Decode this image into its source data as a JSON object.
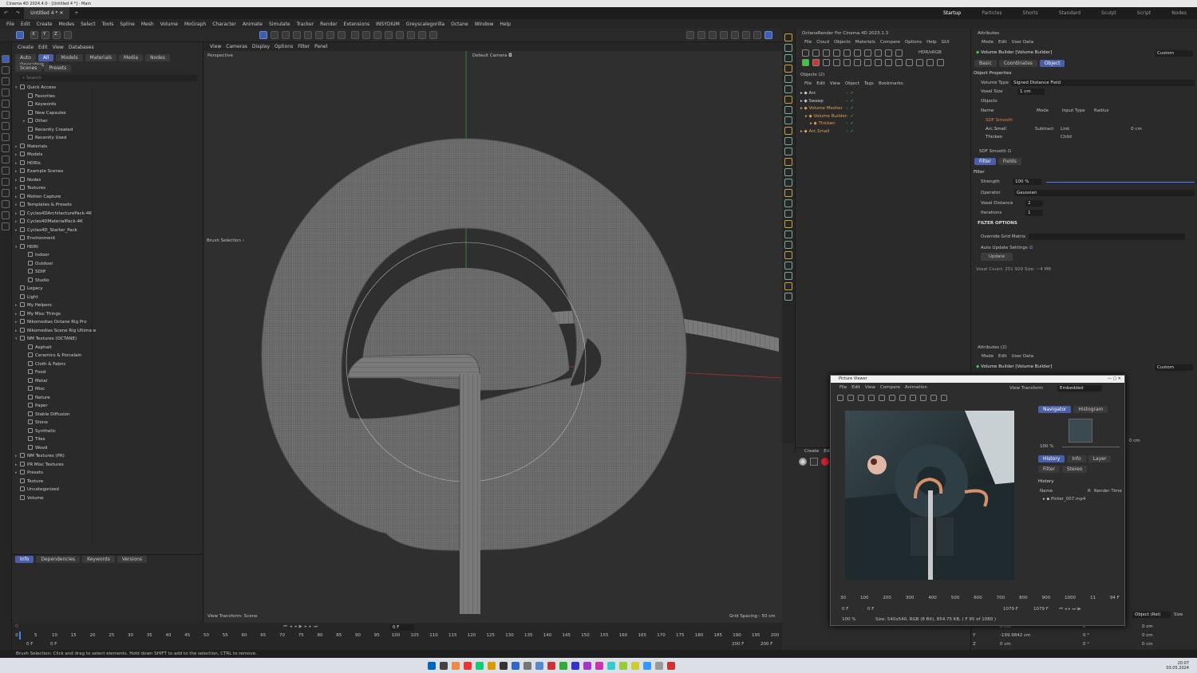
{
  "window": {
    "os_title": "Cinema 4D 2024.4.0 - [Untitled 4 *] - Main",
    "doc_tab": "Untitled 4 *",
    "layouts": [
      "Startup",
      "Particles",
      "Shorts",
      "Standard",
      "Sculpt",
      "Script",
      "Nodes"
    ],
    "active_layout": "Startup"
  },
  "menu": [
    "File",
    "Edit",
    "Create",
    "Modes",
    "Select",
    "Tools",
    "Spline",
    "Mesh",
    "Volume",
    "MoGraph",
    "Character",
    "Animate",
    "Simulate",
    "Tracker",
    "Render",
    "Extensions",
    "INSYDIUM",
    "Greyscalegorilla",
    "Octane",
    "Window",
    "Help"
  ],
  "toolbar": {
    "axes": [
      "X",
      "Y",
      "Z"
    ]
  },
  "assets": {
    "menu": [
      "Create",
      "Edit",
      "View",
      "Databases"
    ],
    "tabs": [
      "Auto",
      "All",
      "Models",
      "Materials",
      "Media",
      "Nodes",
      "Operators"
    ],
    "active_tab": "All",
    "subtabs": [
      "Scenes",
      "Presets"
    ],
    "search_placeholder": "Search",
    "tree": [
      {
        "label": "Quick Access",
        "level": 0,
        "exp": "▾"
      },
      {
        "label": "Favorites",
        "level": 1,
        "exp": ""
      },
      {
        "label": "Keywords",
        "level": 1,
        "exp": ""
      },
      {
        "label": "New Capsules",
        "level": 1,
        "exp": ""
      },
      {
        "label": "Other",
        "level": 1,
        "exp": "▸"
      },
      {
        "label": "Recently Created",
        "level": 1,
        "exp": ""
      },
      {
        "label": "Recently Used",
        "level": 1,
        "exp": ""
      },
      {
        "label": "Materials",
        "level": 0,
        "exp": "▸"
      },
      {
        "label": "Models",
        "level": 0,
        "exp": "▸"
      },
      {
        "label": "HDRIs",
        "level": 0,
        "exp": "▸"
      },
      {
        "label": "Example Scenes",
        "level": 0,
        "exp": "▸"
      },
      {
        "label": "Nodes",
        "level": 0,
        "exp": "▸"
      },
      {
        "label": "Textures",
        "level": 0,
        "exp": "▸"
      },
      {
        "label": "Motion Capture",
        "level": 0,
        "exp": "▸"
      },
      {
        "label": "Templates & Presets",
        "level": 0,
        "exp": "▸"
      },
      {
        "label": "Cycles4DArchitecturePack-4K",
        "level": 0,
        "exp": "▸"
      },
      {
        "label": "Cycles4DMaterialPack-4K",
        "level": 0,
        "exp": "▸"
      },
      {
        "label": "Cycles4D_Starter_Pack",
        "level": 0,
        "exp": "▸"
      },
      {
        "label": "Environment",
        "level": 0,
        "exp": ""
      },
      {
        "label": "HDRI",
        "level": 0,
        "exp": "▾"
      },
      {
        "label": "Indoor",
        "level": 1,
        "exp": ""
      },
      {
        "label": "Outdoor",
        "level": 1,
        "exp": ""
      },
      {
        "label": "SDiff",
        "level": 1,
        "exp": ""
      },
      {
        "label": "Studio",
        "level": 1,
        "exp": ""
      },
      {
        "label": "Legacy",
        "level": 0,
        "exp": ""
      },
      {
        "label": "Light",
        "level": 0,
        "exp": ""
      },
      {
        "label": "My Helpers",
        "level": 0,
        "exp": "▸"
      },
      {
        "label": "My Misc Things",
        "level": 0,
        "exp": "▸"
      },
      {
        "label": "Nikomedias Octane Rig Pro",
        "level": 0,
        "exp": "▸"
      },
      {
        "label": "Nikomedias Scene Rig Ultimate",
        "level": 0,
        "exp": "▸"
      },
      {
        "label": "NM Textures (OCTANE)",
        "level": 0,
        "exp": "▾"
      },
      {
        "label": "Asphalt",
        "level": 1,
        "exp": ""
      },
      {
        "label": "Ceramics & Porcelain",
        "level": 1,
        "exp": ""
      },
      {
        "label": "Cloth & Fabric",
        "level": 1,
        "exp": ""
      },
      {
        "label": "Food",
        "level": 1,
        "exp": ""
      },
      {
        "label": "Metal",
        "level": 1,
        "exp": ""
      },
      {
        "label": "Misc",
        "level": 1,
        "exp": ""
      },
      {
        "label": "Nature",
        "level": 1,
        "exp": ""
      },
      {
        "label": "Paper",
        "level": 1,
        "exp": ""
      },
      {
        "label": "Stable Diffusion",
        "level": 1,
        "exp": ""
      },
      {
        "label": "Stone",
        "level": 1,
        "exp": ""
      },
      {
        "label": "Synthetic",
        "level": 1,
        "exp": ""
      },
      {
        "label": "Tiles",
        "level": 1,
        "exp": ""
      },
      {
        "label": "Wood",
        "level": 1,
        "exp": ""
      },
      {
        "label": "NM Textures (PR)",
        "level": 0,
        "exp": "▸"
      },
      {
        "label": "PR Misc Textures",
        "level": 0,
        "exp": "▸"
      },
      {
        "label": "Presets",
        "level": 0,
        "exp": "▸"
      },
      {
        "label": "Texture",
        "level": 0,
        "exp": ""
      },
      {
        "label": "Uncategorized",
        "level": 0,
        "exp": ""
      },
      {
        "label": "Volume",
        "level": 0,
        "exp": ""
      }
    ],
    "bottom_tabs": [
      "Info",
      "Dependencies",
      "Keywords",
      "Versions"
    ],
    "active_bottom_tab": "Info"
  },
  "viewport": {
    "menu": [
      "View",
      "Cameras",
      "Display",
      "Options",
      "Filter",
      "Panel"
    ],
    "mode": "Perspective",
    "camera": "Default Camera",
    "brush_label": "Brush Selection",
    "view_transform": "View Transform: Scene",
    "grid_spacing": "Grid Spacing : 50 cm"
  },
  "octane": {
    "title": "OctaneRender For Cinema 4D 2023.1.3",
    "menu": [
      "File",
      "Cloud",
      "Objects",
      "Materials",
      "Compare",
      "Options",
      "Help",
      "GUI"
    ],
    "hdr": "HDR/sRGB"
  },
  "objects": {
    "menu": [
      "File",
      "Edit",
      "View",
      "Object",
      "Tags",
      "Bookmarks"
    ],
    "header": "Objects (2)",
    "items": [
      {
        "name": "Arc",
        "level": 0,
        "color": "#d0d0d0"
      },
      {
        "name": "Sweep",
        "level": 0,
        "color": "#d0d0d0"
      },
      {
        "name": "Volume Mesher",
        "level": 0,
        "color": "#e0a050"
      },
      {
        "name": "Volume Builder",
        "level": 1,
        "color": "#e0a050"
      },
      {
        "name": "Thicken",
        "level": 2,
        "color": "#e0a050"
      },
      {
        "name": "Arc.Small",
        "level": 0,
        "color": "#e0a050"
      }
    ]
  },
  "attributes": {
    "header": "Attributes",
    "menu": [
      "Mode",
      "Edit",
      "User Data"
    ],
    "object": "Volume Builder [Volume Builder]",
    "preset": "Custom",
    "tabs": [
      "Basic",
      "Coordinates",
      "Object"
    ],
    "active_tab": "Object",
    "section": "Object Properties",
    "volume_type_label": "Volume Type",
    "volume_type": "Signed Distance Field",
    "voxel_size_label": "Voxel Size",
    "voxel_size": "1 cm",
    "objects_label": "Objects",
    "cols": [
      "Name",
      "Mode",
      "Input Type",
      "Radius"
    ],
    "rows": [
      {
        "name": "SDF Smooth",
        "mode": "",
        "input": "",
        "radius": ""
      },
      {
        "name": "Arc.Small",
        "mode": "Subtract",
        "input": "Link",
        "radius": "0 cm"
      },
      {
        "name": "Thicken",
        "mode": "",
        "input": "Child",
        "radius": ""
      }
    ],
    "sdf_label": "SDF Smooth",
    "filter_tabs": [
      "Filter",
      "Fields"
    ],
    "filter_header": "Filter",
    "strength_label": "Strength",
    "strength": "100 %",
    "strength_level": 1.0,
    "operator_label": "Operator",
    "operator": "Gaussian",
    "voxel_distance_label": "Voxel Distance",
    "voxel_distance": "2",
    "iterations_label": "Iterations",
    "iterations": "1",
    "filter_options": "FILTER OPTIONS",
    "override_label": "Override Grid Matrix",
    "auto_update_label": "Auto Update Settings",
    "update_btn": "Update",
    "voxel_count": "Voxel Count: 251 929   Size: ~4 MB"
  },
  "attributes2": {
    "header": "Attributes (2)",
    "menu": [
      "Mode",
      "Edit",
      "User Data"
    ],
    "object": "Volume Builder [Volume Builder]",
    "preset": "Custom",
    "side_value": "0 cm",
    "coord_mode": "Object (Rel)",
    "size_label": "Size",
    "coords": [
      {
        "axis": "",
        "a": "",
        "b": "0 cm",
        "c": "0 °",
        "d": "0 cm"
      },
      {
        "axis": "Y",
        "a": "",
        "b": "-199.9842 cm",
        "c": "0 °",
        "d": "0 cm"
      },
      {
        "axis": "Z",
        "a": "",
        "b": "0 cm",
        "c": "0 °",
        "d": "0 cm"
      }
    ]
  },
  "materials": {
    "menu": [
      "Create",
      "Edit"
    ]
  },
  "picture_viewer": {
    "title": "Picture Viewer",
    "menu": [
      "File",
      "Edit",
      "View",
      "Compare",
      "Animation"
    ],
    "view_transform_label": "View Transform",
    "view_transform": "Embedded",
    "tabs": [
      "Navigator",
      "Histogram"
    ],
    "zoom": "100 %",
    "tabs2": [
      "History",
      "Info",
      "Layer"
    ],
    "tabs3": [
      "Filter",
      "Stereo"
    ],
    "history_label": "History",
    "history_cols": [
      "Name",
      "R",
      "Render Time"
    ],
    "history_item": "Pinter_007.mp4",
    "ruler": [
      "30",
      "100",
      "200",
      "300",
      "400",
      "500",
      "600",
      "700",
      "800",
      "900",
      "1000",
      "11",
      "94 F"
    ],
    "frame_start": "0 F",
    "frame_mid": "0 F",
    "frame_end": "1079 F",
    "frame_end2": "1079 F",
    "status_zoom": "100 %",
    "size_info": "Size: 540x540, RGB (8 Bit), 854.75 KB, ( F 95 of 1080 )"
  },
  "timeline": {
    "ticks": [
      "0",
      "5",
      "10",
      "15",
      "20",
      "25",
      "30",
      "35",
      "40",
      "45",
      "50",
      "55",
      "60",
      "65",
      "70",
      "75",
      "80",
      "85",
      "90",
      "95",
      "100",
      "105",
      "110",
      "115",
      "120",
      "125",
      "130",
      "135",
      "140",
      "145",
      "150",
      "155",
      "160",
      "165",
      "170",
      "175",
      "180",
      "185",
      "190",
      "195",
      "200"
    ],
    "current": "0 F",
    "start": "0 F",
    "start2": "0 F",
    "end": "200 F",
    "end2": "200 F"
  },
  "status": "Brush Selection: Click and drag to select elements. Hold down SHIFT to add to the selection, CTRL to remove.",
  "clock": {
    "time": "20:07",
    "date": "03.05.2024"
  },
  "colors": {
    "accent": "#4a5fa8",
    "orange": "#e0a050",
    "bg": "#2b2b2b"
  }
}
